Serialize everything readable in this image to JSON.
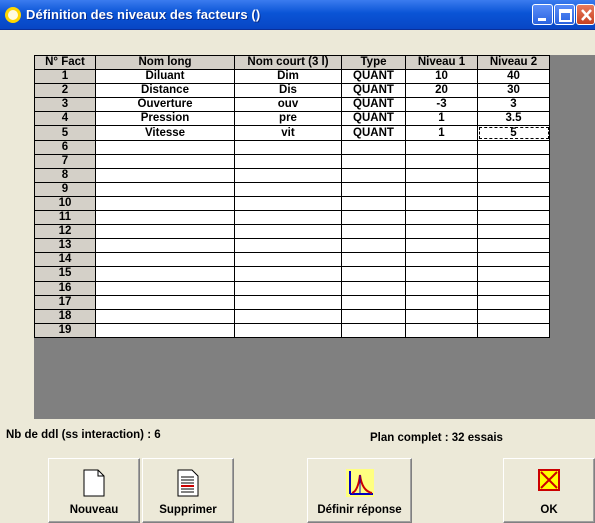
{
  "window": {
    "title": "Définition des niveaux des facteurs ()"
  },
  "table": {
    "headers": [
      "N° Fact",
      "Nom long",
      "Nom court (3 l)",
      "Type",
      "Niveau 1",
      "Niveau 2"
    ],
    "rows": [
      [
        "1",
        "Diluant",
        "Dim",
        "QUANT",
        "10",
        "40"
      ],
      [
        "2",
        "Distance",
        "Dis",
        "QUANT",
        "20",
        "30"
      ],
      [
        "3",
        "Ouverture",
        "ouv",
        "QUANT",
        "-3",
        "3"
      ],
      [
        "4",
        "Pression",
        "pre",
        "QUANT",
        "1",
        "3.5"
      ],
      [
        "5",
        "Vitesse",
        "vit",
        "QUANT",
        "1",
        "5"
      ],
      [
        "6",
        "",
        "",
        "",
        "",
        ""
      ],
      [
        "7",
        "",
        "",
        "",
        "",
        ""
      ],
      [
        "8",
        "",
        "",
        "",
        "",
        ""
      ],
      [
        "9",
        "",
        "",
        "",
        "",
        ""
      ],
      [
        "10",
        "",
        "",
        "",
        "",
        ""
      ],
      [
        "11",
        "",
        "",
        "",
        "",
        ""
      ],
      [
        "12",
        "",
        "",
        "",
        "",
        ""
      ],
      [
        "13",
        "",
        "",
        "",
        "",
        ""
      ],
      [
        "14",
        "",
        "",
        "",
        "",
        ""
      ],
      [
        "15",
        "",
        "",
        "",
        "",
        ""
      ],
      [
        "16",
        "",
        "",
        "",
        "",
        ""
      ],
      [
        "17",
        "",
        "",
        "",
        "",
        ""
      ],
      [
        "18",
        "",
        "",
        "",
        "",
        ""
      ],
      [
        "19",
        "",
        "",
        "",
        "",
        ""
      ]
    ]
  },
  "status": {
    "ddl": "Nb de ddl (ss interaction) : 6",
    "plan": "Plan complet : 32 essais"
  },
  "buttons": {
    "nouveau": "Nouveau",
    "supprimer": "Supprimer",
    "definir": "Définir réponse",
    "ok": "OK"
  },
  "icons": {
    "nouveau": "blank-page-icon",
    "supprimer": "document-lines-icon",
    "definir": "response-curve-icon",
    "ok": "red-x-icon"
  },
  "colors": {
    "titlebar": "#0a54d6",
    "grid_background": "#808080",
    "header_cell": "#d4d0c8"
  }
}
